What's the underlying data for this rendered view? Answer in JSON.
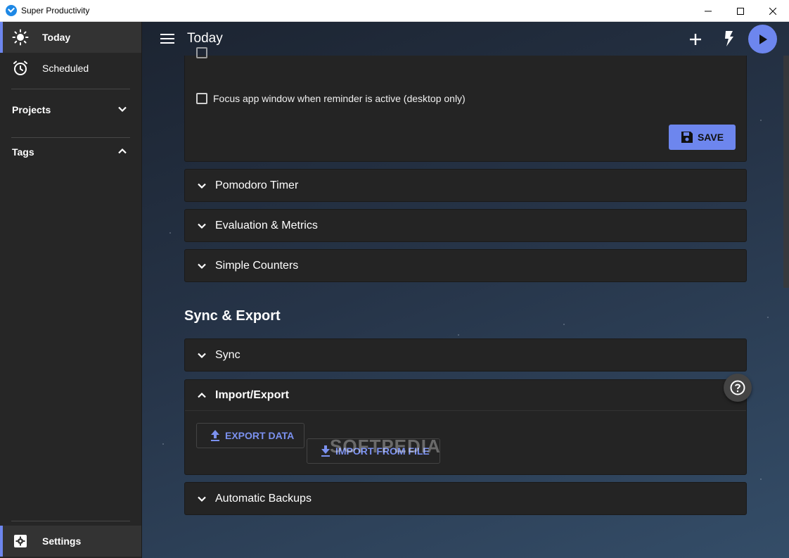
{
  "window": {
    "title": "Super Productivity",
    "controls": {
      "minimize": "minimize-icon",
      "maximize": "maximize-icon",
      "close": "close-icon"
    }
  },
  "sidebar": {
    "today": "Today",
    "scheduled": "Scheduled",
    "projects": "Projects",
    "tags": "Tags",
    "settings": "Settings"
  },
  "header": {
    "title": "Today"
  },
  "settings_page": {
    "top_card": {
      "checkbox_focus": "Focus app window when reminder is active (desktop only)",
      "save_label": "SAVE"
    },
    "panels": {
      "pomodoro": "Pomodoro Timer",
      "evaluation": "Evaluation & Metrics",
      "counters": "Simple Counters"
    },
    "sync_export_heading": "Sync & Export",
    "sync_panel": "Sync",
    "import_export": {
      "title": "Import/Export",
      "export_label": "EXPORT DATA",
      "import_label": "IMPORT FROM FILE"
    },
    "backups_panel": "Automatic Backups"
  },
  "watermark": "SOFTPEDIA",
  "colors": {
    "accent": "#6d86ee",
    "sidebar_bg": "#262626",
    "card_bg": "#242424"
  }
}
